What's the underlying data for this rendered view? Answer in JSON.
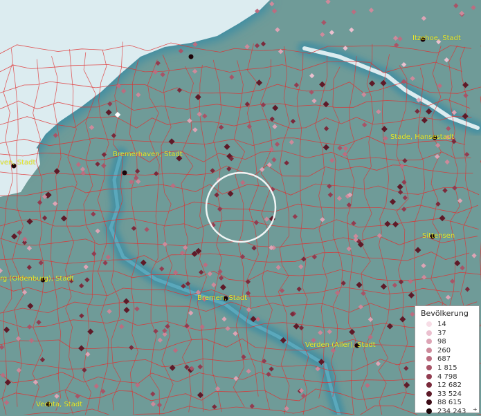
{
  "map": {
    "colors": {
      "land": "#6f9b98",
      "water": "#dcecf0",
      "river": "#3f8ea3",
      "borders": "#e03030",
      "label": "#eaeb2a"
    },
    "cities": [
      {
        "name": "Itzehoe, Stadt"
      },
      {
        "name": "Stade, Hansestadt"
      },
      {
        "name": "Bremerhaven, Stadt"
      },
      {
        "name": "ven, Stadt"
      },
      {
        "name": "Sittensen"
      },
      {
        "name": "rg (Oldenburg), Stadt"
      },
      {
        "name": "Bremen, Stadt"
      },
      {
        "name": "Verden (Aller), Stadt"
      },
      {
        "name": "Vechta, Stadt"
      }
    ],
    "selection_circle": {
      "icon": "selection-circle-icon"
    }
  },
  "legend": {
    "title": "Bevölkerung",
    "items": [
      {
        "value": "14",
        "color": "#f7dde6"
      },
      {
        "value": "37",
        "color": "#ebc0cf"
      },
      {
        "value": "98",
        "color": "#dda4b5"
      },
      {
        "value": "260",
        "color": "#cd8a9b"
      },
      {
        "value": "687",
        "color": "#bb6d80"
      },
      {
        "value": "1 815",
        "color": "#a85467"
      },
      {
        "value": "4 798",
        "color": "#923c50"
      },
      {
        "value": "12 682",
        "color": "#7a2a3b"
      },
      {
        "value": "33 524",
        "color": "#5e1a28"
      },
      {
        "value": "88 615",
        "color": "#3e0d17"
      },
      {
        "value": "234 243",
        "color": "#1c0408"
      }
    ],
    "last_suffix": "+"
  }
}
